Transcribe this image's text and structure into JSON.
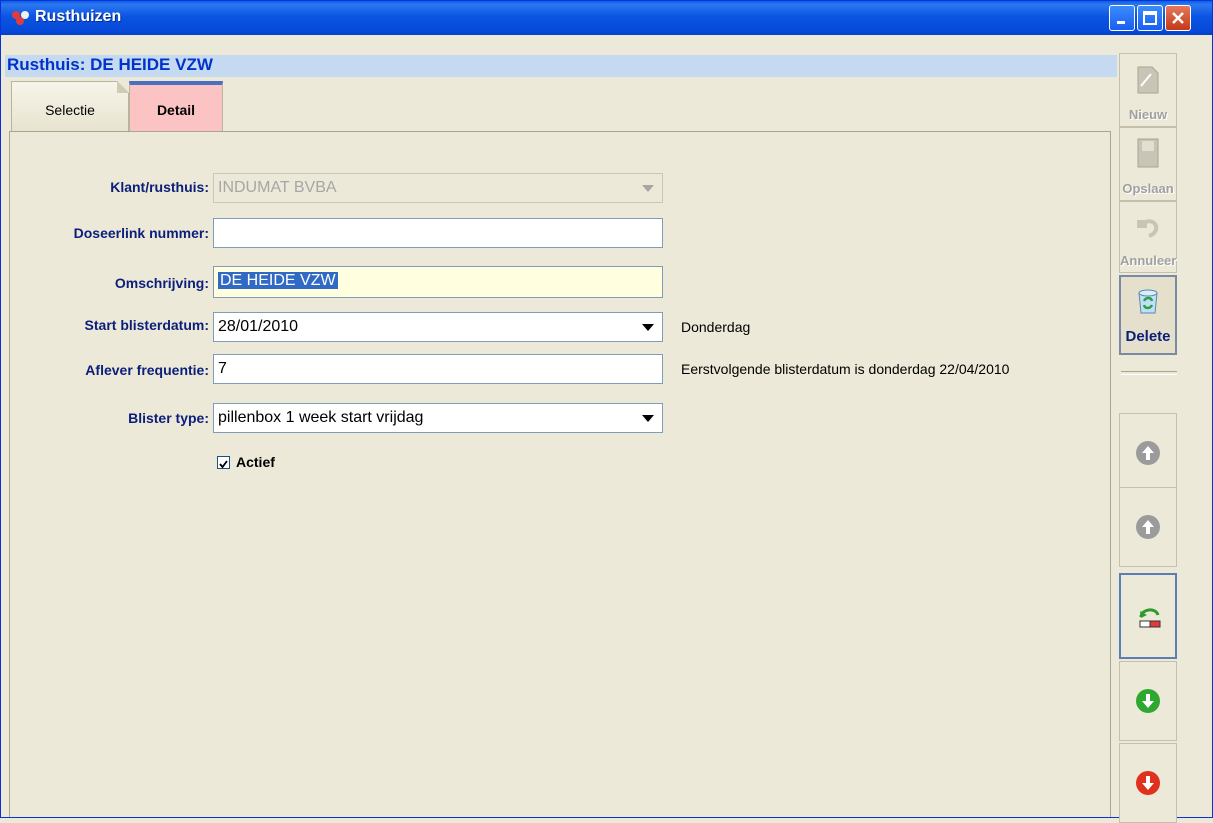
{
  "window": {
    "title": "Rusthuizen",
    "controls": [
      "minimize-icon",
      "maximize-icon",
      "close-icon"
    ]
  },
  "header": {
    "title": "Rusthuis: DE HEIDE VZW"
  },
  "tabs": [
    {
      "label": "Selectie",
      "active": false
    },
    {
      "label": "Detail",
      "active": true
    }
  ],
  "form": {
    "klant": {
      "label": "Klant/rusthuis:",
      "value": "INDUMAT BVBA"
    },
    "doseerlink": {
      "label": "Doseerlink nummer:",
      "value": ""
    },
    "omschrijving": {
      "label": "Omschrijving:",
      "value": "DE HEIDE VZW"
    },
    "start": {
      "label": "Start blisterdatum:",
      "value": "28/01/2010",
      "note": "Donderdag"
    },
    "frequentie": {
      "label": "Aflever frequentie:",
      "value": "7",
      "note": "Eerstvolgende blisterdatum is donderdag 22/04/2010"
    },
    "blister": {
      "label": "Blister type:",
      "value": "pillenbox 1 week start vrijdag"
    },
    "actief": {
      "label": "Actief",
      "checked": true
    }
  },
  "toolbar": {
    "nieuw": "Nieuw",
    "opslaan": "Opslaan",
    "annuleer": "Annuleer",
    "delete": "Delete"
  },
  "nav_icons": [
    "first-record-icon",
    "previous-record-icon",
    "go-to-record-icon",
    "next-record-icon",
    "last-record-icon"
  ],
  "colors": {
    "title_bar": "#0648d8",
    "header_text": "#0033cc",
    "header_bg": "#c5d9f1",
    "active_tab": "#fbc3c3",
    "label_text": "#0b1f7a"
  }
}
